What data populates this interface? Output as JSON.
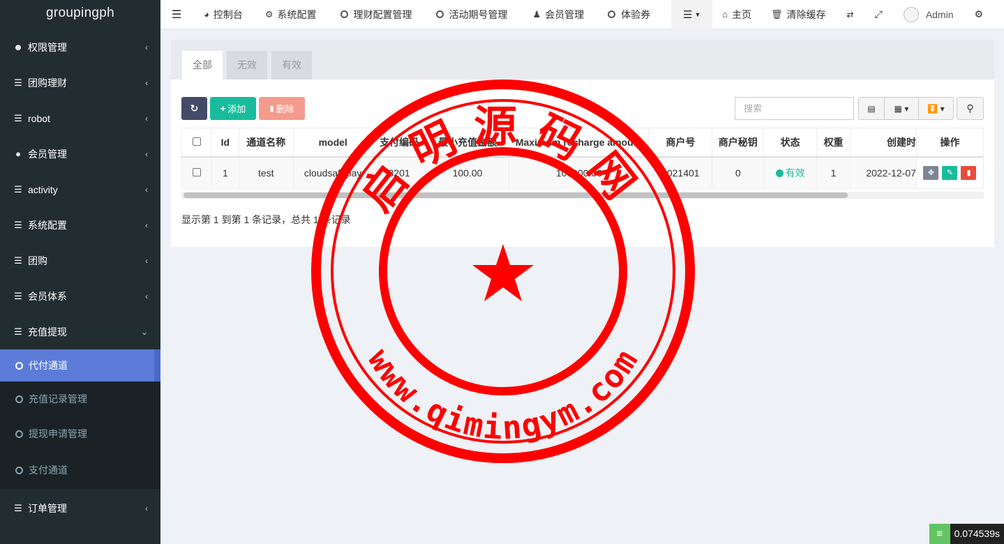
{
  "brand": "groupingph",
  "sidebar": {
    "items": [
      {
        "label": "权限管理",
        "icon": "users-icon"
      },
      {
        "label": "团购理财",
        "icon": "list-icon"
      },
      {
        "label": "robot",
        "icon": "list-icon"
      },
      {
        "label": "会员管理",
        "icon": "user-circle-icon"
      },
      {
        "label": "activity",
        "icon": "list-icon"
      },
      {
        "label": "系统配置",
        "icon": "list-icon"
      },
      {
        "label": "团购",
        "icon": "list-icon"
      },
      {
        "label": "会员体系",
        "icon": "list-icon"
      },
      {
        "label": "充值提现",
        "icon": "list-icon"
      }
    ],
    "sub_items": [
      {
        "label": "代付通道",
        "active": true
      },
      {
        "label": "充值记录管理"
      },
      {
        "label": "提现申请管理"
      },
      {
        "label": "支付通道"
      }
    ],
    "last_item": {
      "label": "订单管理",
      "icon": "list-icon"
    }
  },
  "topbar": {
    "items": [
      "控制台",
      "系统配置",
      "理财配置管理",
      "活动期号管理",
      "会员管理",
      "体验券"
    ],
    "home": "主页",
    "clear_cache": "清除缓存",
    "user": "Admin"
  },
  "tabs": [
    "全部",
    "无效",
    "有效"
  ],
  "toolbar": {
    "add": "添加",
    "delete": "删除"
  },
  "search": {
    "placeholder": "搜索"
  },
  "table": {
    "headers": [
      "Id",
      "通道名称",
      "model",
      "支付编码",
      "最小充值金额",
      "Maximum recharge amount",
      "商户号",
      "商户秘钥",
      "状态",
      "权重",
      "创建时",
      "操作"
    ],
    "rows": [
      {
        "id": "1",
        "name": "test",
        "model": "cloudsafepay",
        "code": "8201",
        "min": "100.00",
        "max": "100000.00",
        "merchant": "2021401",
        "secret": "0",
        "status": "有效",
        "weight": "1",
        "created": "2022-12-07"
      }
    ]
  },
  "pageinfo": "显示第 1 到第 1 条记录，总共 1 条记录",
  "stamp": {
    "top_text": "启明源码网",
    "bottom_text": "www.qimingym.com",
    "color": "#ff0000"
  },
  "timer": "0.074539s"
}
